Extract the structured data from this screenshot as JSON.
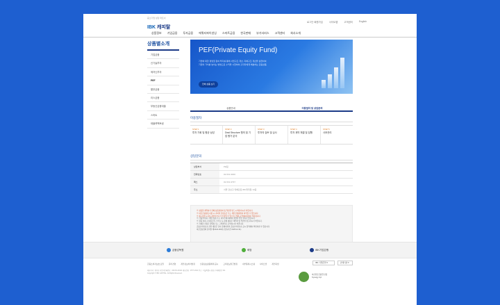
{
  "header": {
    "logo_sub": "중소기업 성장 파트너",
    "logo_brand": "IBK",
    "logo_name": "캐피탈",
    "util_links": [
      "로그인·회원가입",
      "사이트맵",
      "고객센터",
      "English"
    ]
  },
  "gnb": [
    "상품정보",
    "기업금융",
    "투자금융",
    "에쿼티파이낸싱",
    "스마트금융",
    "한국판매",
    "부가서비스",
    "고객센터",
    "회사소개"
  ],
  "lnb": {
    "title": "상품별소개",
    "items": [
      "기업금융",
      "신기술투자",
      "메자닌투자",
      "PEF",
      "할부금융",
      "리스금융",
      "부동산금융대출",
      "스마트",
      "태블렛팩토링"
    ],
    "active_index": 3
  },
  "hero": {
    "title": "PEF(Private Equity Fund)",
    "desc1": "기업에 대한 경영권 참여 투자를 통해 사업구조 개선, 지배구조 개선을 실현하여",
    "desc2": "기업의 가치를 높이는 방법으로 수익을 시현하여 출자자에게 배분하는 금융상품",
    "button": "전체 상품 보기"
  },
  "tabs": [
    "상품안내",
    "이용절차 및 상담문의"
  ],
  "active_tab": 1,
  "process": {
    "title": "이용절차",
    "steps": [
      {
        "no": "STEP 1",
        "text": "투자 기회 및 평균 상담"
      },
      {
        "no": "STEP 2",
        "text": "Deal Structure 협의 및 기업 평가 분석"
      },
      {
        "no": "STEP 3",
        "text": "투자의 검토 및 심사"
      },
      {
        "no": "STEP 4",
        "text": "투자 계약 체결 및 집행"
      },
      {
        "no": "STEP 5",
        "text": "사후관리"
      }
    ]
  },
  "contact": {
    "title": "상담문의",
    "rows": [
      {
        "key": "상담부서",
        "value": "PE팀"
      },
      {
        "key": "전화번호",
        "value": "02-531-9000"
      },
      {
        "key": "팩스",
        "value": "02-531-9797"
      },
      {
        "key": "주소",
        "value": "서울 강남구 테헤란로 IBK캐피탈 10층"
      }
    ]
  },
  "notice": {
    "lines_warn": [
      "※ 상품을 계약하기 전에 상품설명서 및 약관을 반드시 확인하시기 바랍니다.",
      "※ 여신금융상품 이용 시 귀하의 신용등급 또는 개인신용평점이 하락할 수 있습니다.",
      "※ 중도상환 시 중도상환수수료가 부과될 수 있으며, 연체 시 연체이자율이 적용됩니다."
    ],
    "lines_normal": [
      "※ 금융소비자는 해당 상품 또는 서비스에 대하여 설명을 받을 권리가 있습니다.",
      "※ 상품 이용 시 대출금리, 수수료 등 상세 내용은 계약서 및 약관을 참고하시기 바랍니다.",
      "※ 자세한 사항은 영업점 또는 고객센터로 문의하시기 바랍니다.",
      "금융소비자보호 관련 내용은 당사 홈페이지의 금융소비자보호 공시 항목에서 확인하실 수 있습니다.",
      "여신금융협회 심의필 제2024-000호 (유효기간 2025.12.31)"
    ]
  },
  "partners": [
    "금융감독원",
    "희망",
    "IBK기업은행"
  ],
  "footer": {
    "links": [
      "금융소비자보호 포털",
      "윤리경영",
      "개인정보처리방침",
      "신용정보활용체제 공시",
      "고객정보취급방침",
      "내부통제시스템",
      "사이트맵",
      "개인회생"
    ],
    "family_site": "IBK 기업은행",
    "family_site2": "관계기관",
    "info1": "대표이사 : 최석호   사업자등록번호 : 220-81-40141   대표전화 : 1577-1641   주소 : 서울특별시 강남구 테헤란로 411",
    "info2": "Copyright © IBK CAPITAL. All Rights Reserved.",
    "cert_line1": "여신전문금융업 인증",
    "cert_line2": "Synergy Up!"
  },
  "colors": {
    "background": "#1e5fd0",
    "brand_navy": "#1b3a87",
    "hero_blue": "#1656c9",
    "step_orange": "#e07b1f",
    "notice_red": "#d9542b"
  }
}
